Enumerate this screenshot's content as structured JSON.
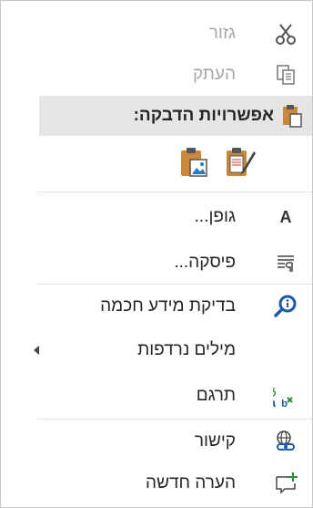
{
  "menu": {
    "cut": {
      "label": "גזור",
      "icon": "scissors-icon",
      "disabled": true
    },
    "copy": {
      "label": "העתק",
      "icon": "copy-icon",
      "disabled": true
    },
    "paste_options": {
      "label": "אפשרויות הדבקה:",
      "icon": "clipboard-paste-icon"
    },
    "paste_buttons": [
      {
        "name": "paste-keep-source-formatting",
        "icon": "paste-brush-icon"
      },
      {
        "name": "paste-picture",
        "icon": "paste-picture-icon"
      }
    ],
    "font": {
      "label": "גופן...",
      "icon": "font-a-icon"
    },
    "paragraph": {
      "label": "פיסקה...",
      "icon": "paragraph-icon"
    },
    "smart_lookup": {
      "label": "בדיקת מידע חכמה",
      "icon": "smart-lookup-icon"
    },
    "synonyms": {
      "label": "מילים נרדפות",
      "icon": "submenu-arrow-icon"
    },
    "translate": {
      "label": "תרגם",
      "icon": "translate-icon"
    },
    "link": {
      "label": "קישור",
      "icon": "link-icon"
    },
    "new_comment": {
      "label": "הערה חדשה",
      "icon": "new-comment-icon"
    }
  }
}
